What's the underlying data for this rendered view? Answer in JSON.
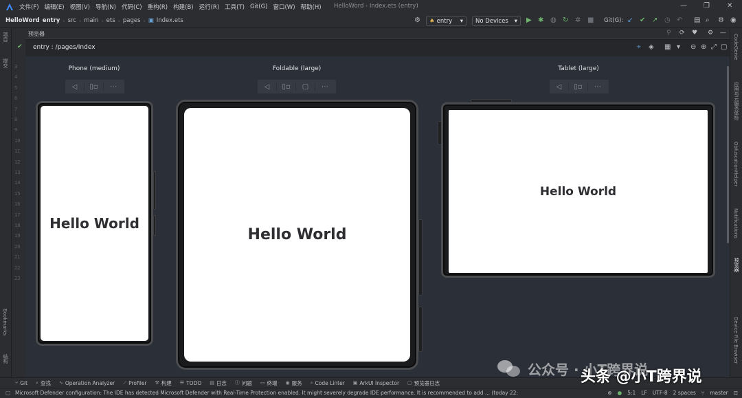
{
  "menu": {
    "items": [
      "文件(F)",
      "编辑(E)",
      "视图(V)",
      "导航(N)",
      "代码(C)",
      "重构(R)",
      "构建(B)",
      "运行(R)",
      "工具(T)",
      "Git(G)",
      "窗口(W)",
      "帮助(H)"
    ],
    "window_title": "HelloWord - Index.ets (entry)"
  },
  "nav": {
    "crumbs": [
      "HelloWord",
      "entry",
      "src",
      "main",
      "ets",
      "pages",
      "Index.ets"
    ],
    "module_select": "entry",
    "device_select": "No Devices",
    "git_label": "Git(G):"
  },
  "left_strip": {
    "project": "项目",
    "commit": "提交",
    "bookmarks": "Bookmarks",
    "structure": "结构"
  },
  "gutter": {
    "lines": [
      "3",
      "4",
      "5",
      "6",
      "7",
      "8",
      "9",
      "10",
      "11",
      "12",
      "13",
      "14",
      "15",
      "16",
      "17",
      "18",
      "19",
      "20",
      "21",
      "22",
      "23"
    ]
  },
  "preview": {
    "panel_title": "预览器",
    "path": "entry : /pages/Index",
    "devices": [
      {
        "label": "Phone (medium)",
        "text": "Hello World"
      },
      {
        "label": "Foldable (large)",
        "text": "Hello World"
      },
      {
        "label": "Tablet (large)",
        "text": "Hello World"
      }
    ],
    "tool_icons": [
      "rotate-icon",
      "multi-device-icon",
      "more-icon"
    ]
  },
  "right_strip": {
    "codegenie": "CodeGenie",
    "app_services": "应用与元服务体检",
    "obfuscation": "ObfuscationHelper",
    "notifications": "Notifications",
    "previewer": "预览器",
    "device_file": "Device File Browser"
  },
  "toolbar": {
    "items": [
      "Git",
      "查找",
      "Operation Analyzer",
      "Profiler",
      "构建",
      "TODO",
      "日志",
      "问题",
      "终端",
      "服务",
      "Code Linter",
      "ArkUI Inspector",
      "预览器日志"
    ]
  },
  "status": {
    "message": "Microsoft Defender configuration: The IDE has detected Microsoft Defender with Real-Time Protection enabled. It might severely degrade IDE performance. It is recommended to add ... (today 22:",
    "position": "5:1",
    "line_sep": "LF",
    "encoding": "UTF-8",
    "indent": "2 spaces",
    "branch": "master"
  },
  "watermark": {
    "brand": "公众号 · 小T跨界说",
    "handle": "头条 @小T跨界说"
  },
  "colors": {
    "ide_bg": "#2b2d30",
    "canvas_bg": "#2b2f37",
    "run_green": "#6fb56f"
  }
}
